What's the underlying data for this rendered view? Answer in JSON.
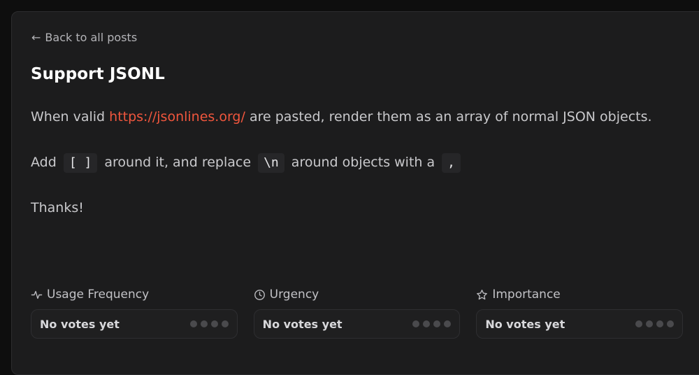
{
  "nav": {
    "back_arrow": "←",
    "back_label": "Back to all posts"
  },
  "post": {
    "title": "Support JSONL",
    "para1_before": "When valid ",
    "para1_link": "https://jsonlines.org/",
    "para1_after": " are pasted, render them as an array of normal JSON objects.",
    "para2_a": "Add ",
    "para2_code1": "[ ]",
    "para2_b": " around it, and replace ",
    "para2_code2": "\\n",
    "para2_c": " around objects with a ",
    "para2_code3": ",",
    "para3": "Thanks!"
  },
  "metrics": [
    {
      "label": "Usage Frequency",
      "icon": "activity-icon",
      "value": "No votes yet",
      "dots_filled": 0,
      "dots_total": 4
    },
    {
      "label": "Urgency",
      "icon": "clock-icon",
      "value": "No votes yet",
      "dots_filled": 0,
      "dots_total": 4
    },
    {
      "label": "Importance",
      "icon": "star-icon",
      "value": "No votes yet",
      "dots_filled": 0,
      "dots_total": 4
    }
  ],
  "colors": {
    "page_bg": "#0e0e0e",
    "card_bg": "#1c1c1d",
    "link": "#f0563d",
    "title": "#ffffff",
    "dot_empty": "#4a4a4d"
  }
}
